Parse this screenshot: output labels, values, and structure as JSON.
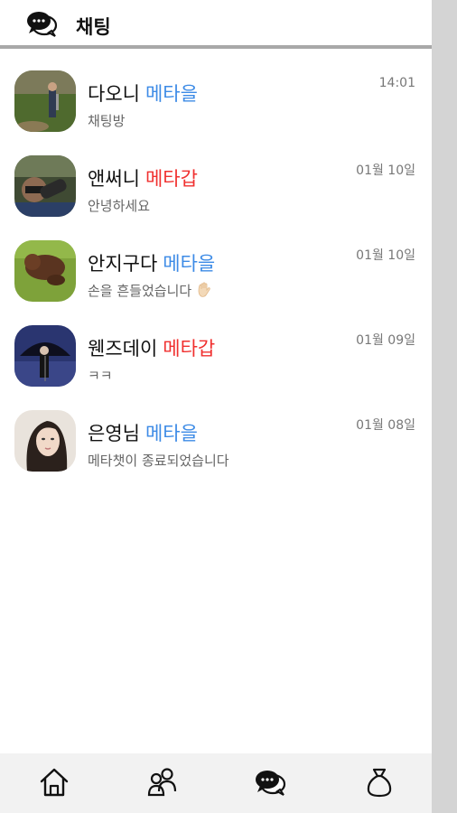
{
  "header": {
    "title": "채팅",
    "icon": "chat-bubbles-icon"
  },
  "chats": [
    {
      "name": "다오니",
      "tag": "메타을",
      "tag_color": "#3d8be6",
      "preview": "채팅방",
      "time": "14:01"
    },
    {
      "name": "앤써니",
      "tag": "메타갑",
      "tag_color": "#f0302f",
      "preview": "안녕하세요",
      "time": "01월 10일"
    },
    {
      "name": "안지구다",
      "tag": "메타을",
      "tag_color": "#3d8be6",
      "preview": "손을 흔들었습니다",
      "preview_emoji": "waving-hand-icon",
      "time": "01월 10일"
    },
    {
      "name": "웬즈데이",
      "tag": "메타갑",
      "tag_color": "#f0302f",
      "preview": "ㅋㅋ",
      "time": "01월 09일"
    },
    {
      "name": "은영님",
      "tag": "메타을",
      "tag_color": "#3d8be6",
      "preview": "메타챗이 종료되었습니다",
      "time": "01월 08일"
    }
  ],
  "bottom_nav": {
    "items": [
      "home-icon",
      "friends-icon",
      "chat-icon",
      "bag-icon"
    ]
  }
}
